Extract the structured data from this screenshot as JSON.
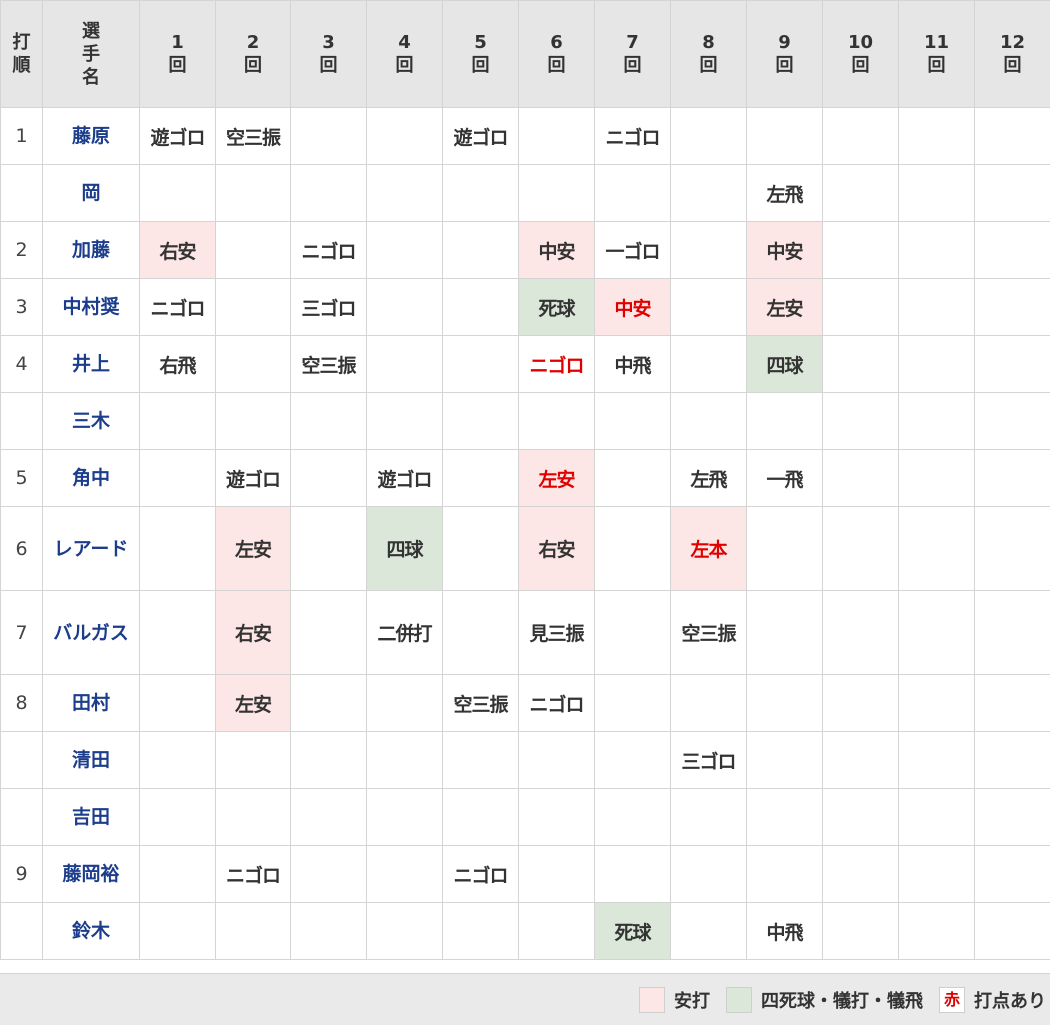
{
  "header": {
    "batting_order": "打順",
    "player": "選手名",
    "innings": [
      {
        "num": "1",
        "unit": "回"
      },
      {
        "num": "2",
        "unit": "回"
      },
      {
        "num": "3",
        "unit": "回"
      },
      {
        "num": "4",
        "unit": "回"
      },
      {
        "num": "5",
        "unit": "回"
      },
      {
        "num": "6",
        "unit": "回"
      },
      {
        "num": "7",
        "unit": "回"
      },
      {
        "num": "8",
        "unit": "回"
      },
      {
        "num": "9",
        "unit": "回"
      },
      {
        "num": "10",
        "unit": "回"
      },
      {
        "num": "11",
        "unit": "回"
      },
      {
        "num": "12",
        "unit": "回"
      }
    ]
  },
  "rows": [
    {
      "order": "1",
      "name": "藤原",
      "results": {
        "1": {
          "text": "遊ゴロ"
        },
        "2": {
          "text": "空三振"
        },
        "5": {
          "text": "遊ゴロ"
        },
        "7": {
          "text": "ニゴロ"
        }
      }
    },
    {
      "order": "",
      "name": "岡",
      "results": {
        "9": {
          "text": "左飛"
        }
      }
    },
    {
      "order": "2",
      "name": "加藤",
      "results": {
        "1": {
          "text": "右安",
          "bg": "hit"
        },
        "3": {
          "text": "ニゴロ"
        },
        "6": {
          "text": "中安",
          "bg": "hit"
        },
        "7": {
          "text": "一ゴロ"
        },
        "9": {
          "text": "中安",
          "bg": "hit"
        }
      }
    },
    {
      "order": "3",
      "name": "中村奨",
      "results": {
        "1": {
          "text": "ニゴロ"
        },
        "3": {
          "text": "三ゴロ"
        },
        "6": {
          "text": "死球",
          "bg": "walk"
        },
        "7": {
          "text": "中安",
          "bg": "hit",
          "rbi": true
        },
        "9": {
          "text": "左安",
          "bg": "hit"
        }
      }
    },
    {
      "order": "4",
      "name": "井上",
      "results": {
        "1": {
          "text": "右飛"
        },
        "3": {
          "text": "空三振"
        },
        "6": {
          "text": "ニゴロ",
          "rbi": true
        },
        "7": {
          "text": "中飛"
        },
        "9": {
          "text": "四球",
          "bg": "walk"
        }
      }
    },
    {
      "order": "",
      "name": "三木",
      "results": {}
    },
    {
      "order": "5",
      "name": "角中",
      "results": {
        "2": {
          "text": "遊ゴロ"
        },
        "4": {
          "text": "遊ゴロ"
        },
        "6": {
          "text": "左安",
          "bg": "hit",
          "rbi": true
        },
        "8": {
          "text": "左飛"
        },
        "9": {
          "text": "一飛"
        }
      }
    },
    {
      "order": "6",
      "name": "レアード",
      "tall": true,
      "results": {
        "2": {
          "text": "左安",
          "bg": "hit"
        },
        "4": {
          "text": "四球",
          "bg": "walk"
        },
        "6": {
          "text": "右安",
          "bg": "hit"
        },
        "8": {
          "text": "左本",
          "bg": "hit",
          "rbi": true
        }
      }
    },
    {
      "order": "7",
      "name": "バルガス",
      "tall": true,
      "results": {
        "2": {
          "text": "右安",
          "bg": "hit"
        },
        "4": {
          "text": "二併打"
        },
        "6": {
          "text": "見三振"
        },
        "8": {
          "text": "空三振"
        }
      }
    },
    {
      "order": "8",
      "name": "田村",
      "results": {
        "2": {
          "text": "左安",
          "bg": "hit"
        },
        "5": {
          "text": "空三振"
        },
        "6": {
          "text": "ニゴロ"
        }
      }
    },
    {
      "order": "",
      "name": "清田",
      "results": {
        "8": {
          "text": "三ゴロ"
        }
      }
    },
    {
      "order": "",
      "name": "吉田",
      "results": {}
    },
    {
      "order": "9",
      "name": "藤岡裕",
      "results": {
        "2": {
          "text": "ニゴロ"
        },
        "5": {
          "text": "ニゴロ"
        }
      }
    },
    {
      "order": "",
      "name": "鈴木",
      "results": {
        "7": {
          "text": "死球",
          "bg": "walk"
        },
        "9": {
          "text": "中飛"
        }
      }
    }
  ],
  "legend": {
    "hit_label": "安打",
    "walk_label": "四死球・犠打・犠飛",
    "rbi_marker": "赤",
    "rbi_label": "打点あり"
  },
  "colors": {
    "hit_bg": "#fde6e6",
    "walk_bg": "#dbe8d9",
    "rbi_text": "#e00000",
    "player_name": "#1c3d8c",
    "header_bg": "#e6e6e6"
  }
}
